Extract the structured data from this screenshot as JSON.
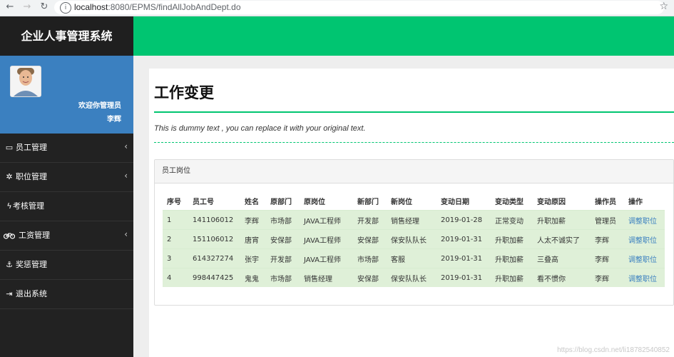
{
  "browser": {
    "url_host": "localhost",
    "url_rest": ":8080/EPMS/findAllJobAndDept.do"
  },
  "header": {
    "brand": "企业人事管理系统"
  },
  "user": {
    "welcome": "欢迎你管理员",
    "name": "李辉"
  },
  "sidebar": {
    "items": [
      {
        "label": "员工管理",
        "icon": "monitor-icon",
        "has_caret": true
      },
      {
        "label": "职位管理",
        "icon": "cogs-icon",
        "has_caret": true
      },
      {
        "label": "考核管理",
        "icon": "bolt-icon",
        "has_caret": false
      },
      {
        "label": "工资管理",
        "icon": "bicycle-icon",
        "has_caret": true
      },
      {
        "label": "奖惩管理",
        "icon": "anchor-icon",
        "has_caret": false
      },
      {
        "label": "退出系统",
        "icon": "sign-out-icon",
        "has_caret": false
      }
    ]
  },
  "main": {
    "title": "工作变更",
    "subtitle": "This is dummy text , you can replace it with your original text.",
    "panel_title": "员工岗位",
    "table": {
      "headers": [
        "序号",
        "员工号",
        "姓名",
        "原部门",
        "原岗位",
        "新部门",
        "新岗位",
        "变动日期",
        "变动类型",
        "变动原因",
        "操作员",
        "操作"
      ],
      "rows": [
        [
          "1",
          "141106012",
          "李辉",
          "市场部",
          "JAVA工程师",
          "开发部",
          "销售经理",
          "2019-01-28",
          "正常变动",
          "升职加薪",
          "管理员",
          "调整职位"
        ],
        [
          "2",
          "151106012",
          "唐宵",
          "安保部",
          "JAVA工程师",
          "安保部",
          "保安队队长",
          "2019-01-31",
          "升职加薪",
          "人太不诚实了",
          "李辉",
          "调整职位"
        ],
        [
          "3",
          "614327274",
          "张宇",
          "开发部",
          "JAVA工程师",
          "市场部",
          "客服",
          "2019-01-31",
          "升职加薪",
          "三叠高",
          "李辉",
          "调整职位"
        ],
        [
          "4",
          "998447425",
          "鬼鬼",
          "市场部",
          "销售经理",
          "安保部",
          "保安队队长",
          "2019-01-31",
          "升职加薪",
          "看不惯你",
          "李辉",
          "调整职位"
        ]
      ]
    }
  },
  "watermark": "https://blog.csdn.net/li18782540852",
  "colors": {
    "accent": "#00c571",
    "sidebar": "#222222",
    "user_panel": "#3b80c0",
    "row_bg": "#dff0d8",
    "link": "#3b80c0"
  }
}
